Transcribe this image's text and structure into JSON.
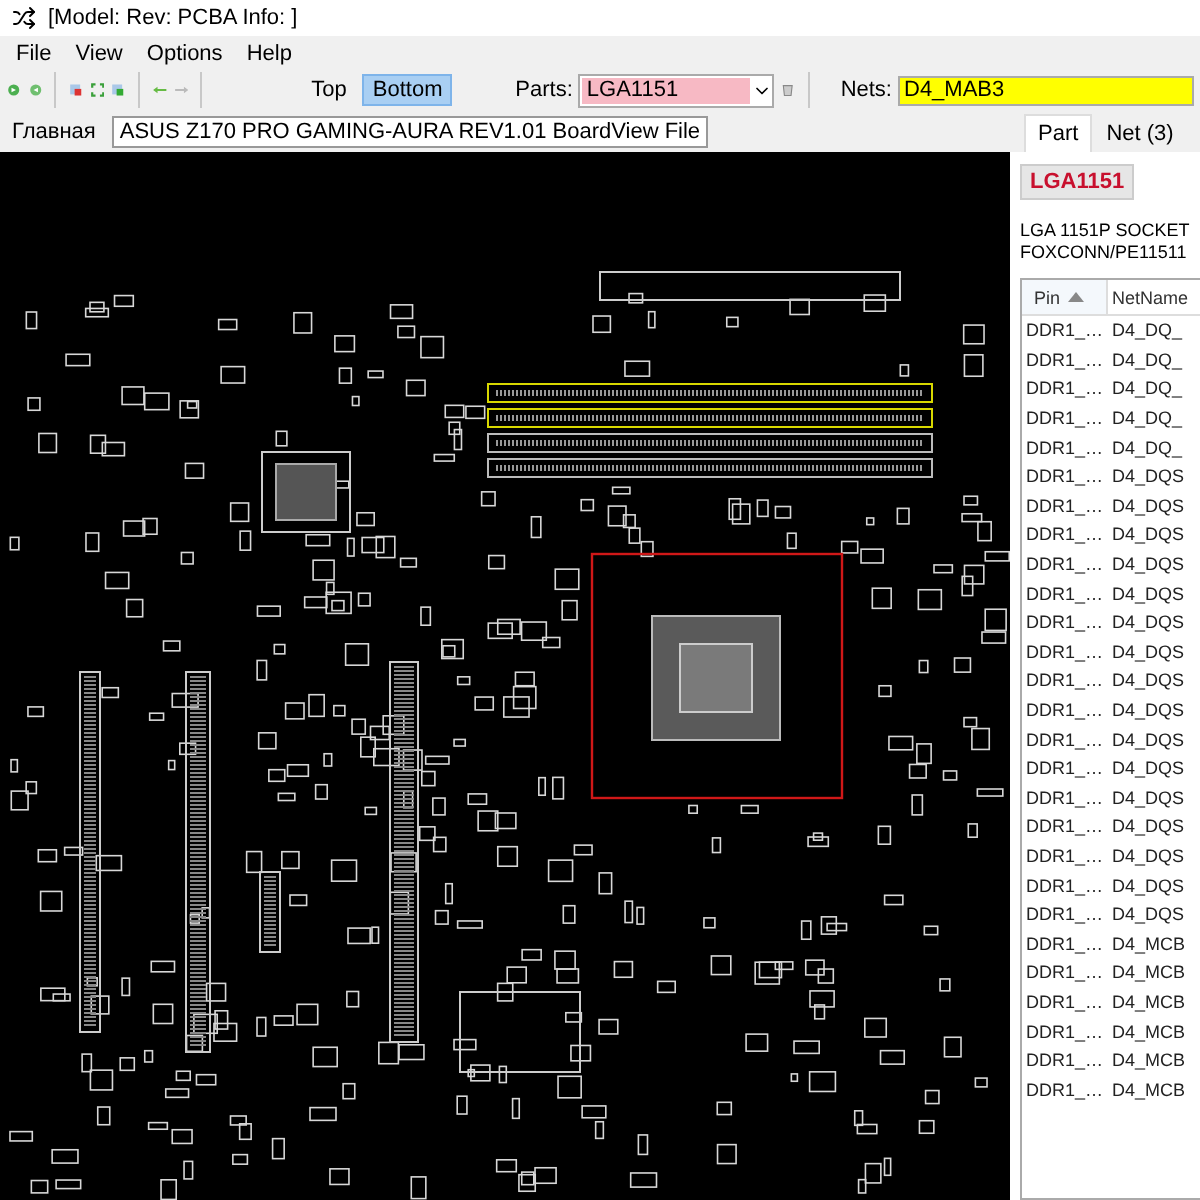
{
  "window": {
    "title": "[Model: Rev:  PCBA Info: ]"
  },
  "menu": [
    "File",
    "View",
    "Options",
    "Help"
  ],
  "toolbar": {
    "side_buttons": [
      {
        "label": "Top",
        "selected": false
      },
      {
        "label": "Bottom",
        "selected": true
      }
    ],
    "parts": {
      "label": "Parts:",
      "value": "LGA1151"
    },
    "nets": {
      "label": "Nets:",
      "value": "D4_MAB3"
    }
  },
  "document_tabs": [
    {
      "label": "Главная",
      "selected": false
    },
    {
      "label": "ASUS Z170 PRO GAMING-AURA REV1.01 BoardView File",
      "selected": true
    }
  ],
  "panel": {
    "tabs": [
      {
        "label": "Part",
        "selected": true
      },
      {
        "label": "Net (3)",
        "selected": false
      }
    ],
    "part_name": "LGA1151",
    "description": [
      "LGA 1151P SOCKET",
      "FOXCONN/PE11511"
    ],
    "columns": [
      {
        "label": "Pin",
        "sorted": true
      },
      {
        "label": "NetName",
        "sorted": false
      }
    ],
    "rows": [
      {
        "pin": "DDR1_…",
        "net": "D4_DQ_"
      },
      {
        "pin": "DDR1_…",
        "net": "D4_DQ_"
      },
      {
        "pin": "DDR1_…",
        "net": "D4_DQ_"
      },
      {
        "pin": "DDR1_…",
        "net": "D4_DQ_"
      },
      {
        "pin": "DDR1_…",
        "net": "D4_DQ_"
      },
      {
        "pin": "DDR1_…",
        "net": "D4_DQS"
      },
      {
        "pin": "DDR1_…",
        "net": "D4_DQS"
      },
      {
        "pin": "DDR1_…",
        "net": "D4_DQS"
      },
      {
        "pin": "DDR1_…",
        "net": "D4_DQS"
      },
      {
        "pin": "DDR1_…",
        "net": "D4_DQS"
      },
      {
        "pin": "DDR1_…",
        "net": "D4_DQS"
      },
      {
        "pin": "DDR1_…",
        "net": "D4_DQS"
      },
      {
        "pin": "DDR1_…",
        "net": "D4_DQS"
      },
      {
        "pin": "DDR1_…",
        "net": "D4_DQS"
      },
      {
        "pin": "DDR1_…",
        "net": "D4_DQS"
      },
      {
        "pin": "DDR1_…",
        "net": "D4_DQS"
      },
      {
        "pin": "DDR1_…",
        "net": "D4_DQS"
      },
      {
        "pin": "DDR1_…",
        "net": "D4_DQS"
      },
      {
        "pin": "DDR1_…",
        "net": "D4_DQS"
      },
      {
        "pin": "DDR1_…",
        "net": "D4_DQS"
      },
      {
        "pin": "DDR1_…",
        "net": "D4_DQS"
      },
      {
        "pin": "DDR1_…",
        "net": "D4_MCB"
      },
      {
        "pin": "DDR1_…",
        "net": "D4_MCB"
      },
      {
        "pin": "DDR1_…",
        "net": "D4_MCB"
      },
      {
        "pin": "DDR1_…",
        "net": "D4_MCB"
      },
      {
        "pin": "DDR1_…",
        "net": "D4_MCB"
      },
      {
        "pin": "DDR1_…",
        "net": "D4_MCB"
      }
    ]
  }
}
